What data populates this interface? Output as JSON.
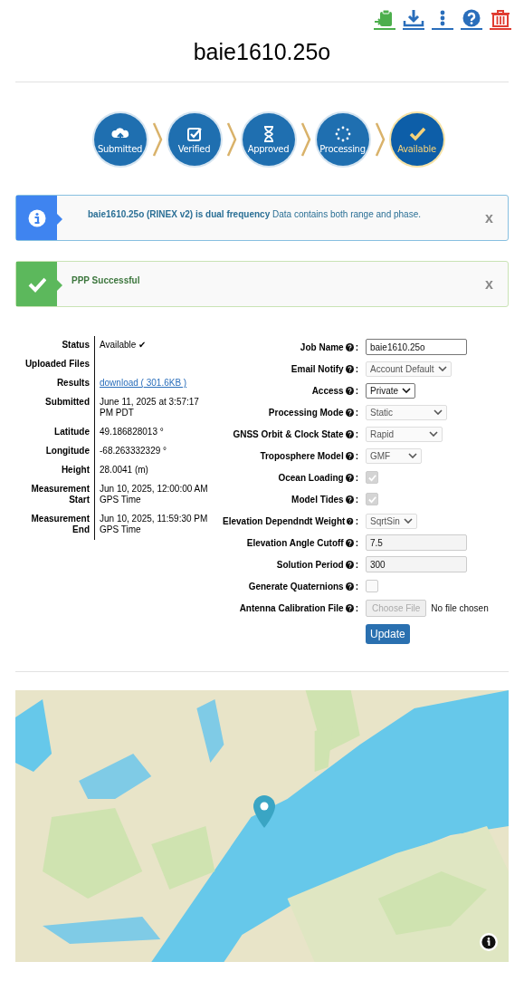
{
  "title": "baie1610.25o",
  "steps": [
    {
      "label": "Submitted",
      "current": false
    },
    {
      "label": "Verified",
      "current": false
    },
    {
      "label": "Approved",
      "current": false
    },
    {
      "label": "Processing",
      "current": false
    },
    {
      "label": "Available",
      "current": true
    }
  ],
  "alerts": [
    {
      "kind": "info",
      "text": "**baie1610.25o (RINEX v2) is dual frequency** Data contains both range and phase.",
      "close": "x"
    },
    {
      "kind": "success",
      "text": "PPP Successful",
      "close": "x"
    }
  ],
  "details": [
    {
      "label": "Status",
      "value": "Available ✔"
    },
    {
      "label": "Uploaded Files"
    },
    {
      "label": "Results",
      "value": "download ( 301.6KB )",
      "kind": "link"
    },
    {
      "label": "Submitted",
      "value": "June 11, 2025 at 3:57:17 PM PDT"
    },
    {
      "label": "Latitude",
      "value": "49.186828013 °"
    },
    {
      "label": "Longitude",
      "value": "-68.263332329 °"
    },
    {
      "label": "Height",
      "value": "28.0041 (m)"
    },
    {
      "label": "Measurement Start",
      "value": "Jun 10, 2025, 12:00:00 AM GPS Time"
    },
    {
      "label": "Measurement End",
      "value": "Jun 10, 2025, 11:59:30 PM GPS Time"
    }
  ],
  "form": {
    "label_suffix": ":",
    "fields": [
      {
        "label": "Job Name",
        "kind": "text",
        "value": "baie1610.25o",
        "disabled": false
      },
      {
        "label": "Email Notify",
        "kind": "select",
        "value": "Account Default",
        "disabled": true
      },
      {
        "label": "Access",
        "kind": "select",
        "value": "Private",
        "disabled": false
      },
      {
        "label": "Processing Mode",
        "kind": "select",
        "value": "Static",
        "disabled": true
      },
      {
        "label": "GNSS Orbit & Clock State",
        "kind": "select",
        "value": "Rapid",
        "disabled": true
      },
      {
        "label": "Troposphere Model",
        "kind": "select",
        "value": "GMF",
        "disabled": true
      },
      {
        "label": "Ocean Loading",
        "kind": "checkbox",
        "checked": true,
        "disabled": true
      },
      {
        "label": "Model Tides",
        "kind": "checkbox",
        "checked": true,
        "disabled": true
      },
      {
        "label": "Elevation Dependndt Weight",
        "kind": "select",
        "value": "SqrtSin",
        "disabled": true
      },
      {
        "label": "Elevation Angle Cutoff",
        "kind": "text",
        "value": "7.5",
        "disabled": true
      },
      {
        "label": "Solution Period",
        "kind": "text",
        "value": "300",
        "disabled": true
      },
      {
        "label": "Generate Quaternions",
        "kind": "checkbox",
        "checked": false,
        "disabled": true
      },
      {
        "label": "Antenna Calibration File",
        "kind": "file",
        "button": "Choose File",
        "status": "No file chosen",
        "disabled": true
      }
    ],
    "submit": "Update"
  }
}
